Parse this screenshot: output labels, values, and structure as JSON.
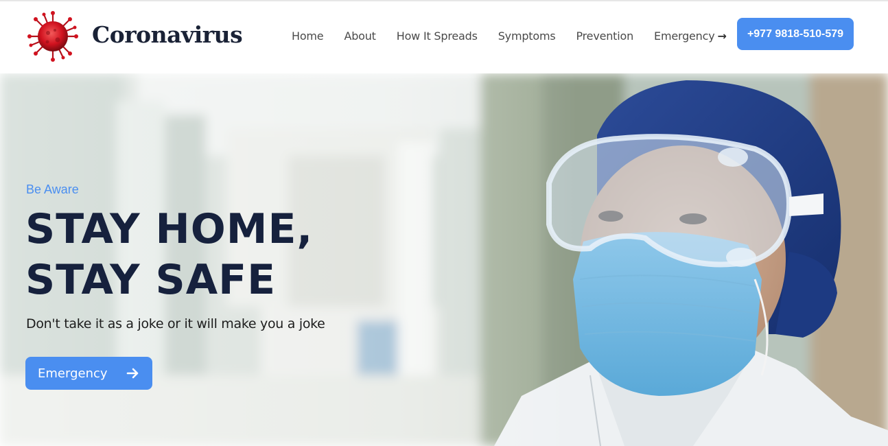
{
  "brand": {
    "name": "Coronavirus",
    "logo_icon": "virus-icon",
    "accent": "#c8102e"
  },
  "nav": {
    "items": [
      {
        "label": "Home"
      },
      {
        "label": "About"
      },
      {
        "label": "How It Spreads"
      },
      {
        "label": "Symptoms"
      },
      {
        "label": "Prevention"
      },
      {
        "label": "Emergency",
        "icon": "arrow-right-icon"
      }
    ]
  },
  "header": {
    "phone_label": "+977 9818-510-579"
  },
  "hero": {
    "eyebrow": "Be Aware",
    "headline": "STAY HOME, STAY SAFE",
    "subtext": "Don't take it as a joke or it will make you a joke",
    "cta_label": "Emergency",
    "cta_icon": "arrow-right-icon"
  },
  "colors": {
    "primary": "#4a8ef0",
    "heading": "#16213d",
    "nav_text": "#4a4a4a"
  }
}
